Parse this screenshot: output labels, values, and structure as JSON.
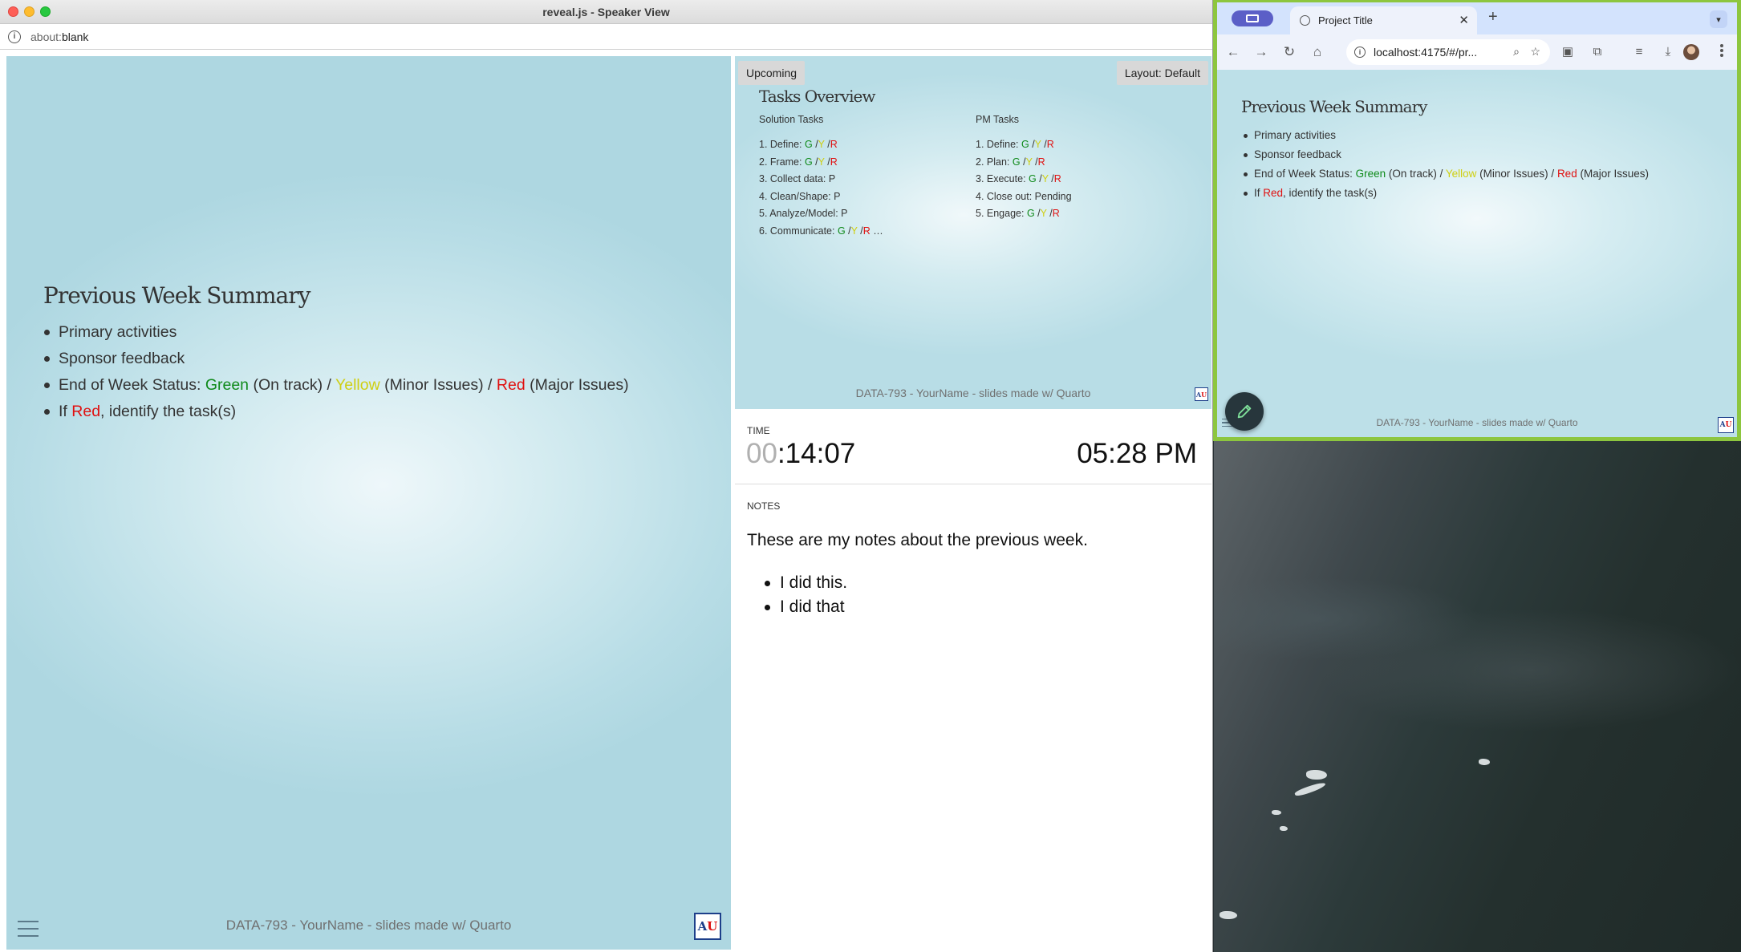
{
  "speaker_window": {
    "title": "reveal.js - Speaker View",
    "url_prefix": "about:",
    "url_rest": "blank"
  },
  "current_slide": {
    "title": "Previous Week Summary",
    "bullets": {
      "b1": "Primary activities",
      "b2": "Sponsor feedback",
      "b3_prefix": "End of Week Status: ",
      "b3_green": "Green",
      "b3_mid1": " (On track) / ",
      "b3_yellow": "Yellow",
      "b3_mid2": " (Minor Issues) / ",
      "b3_red": "Red",
      "b3_suffix": " (Major Issues)",
      "b4_prefix": "If ",
      "b4_red": "Red",
      "b4_suffix": ", identify the task(s)"
    },
    "footer": "DATA-793 - YourName - slides made w/ Quarto",
    "logo_left": "A",
    "logo_right": "U"
  },
  "upcoming": {
    "label": "Upcoming",
    "layout_label": "Layout: Default",
    "title": "Tasks Overview",
    "solution_title": "Solution Tasks",
    "pm_title": "PM Tasks",
    "gyr": {
      "g": "G",
      "sep1": " /",
      "y": "Y",
      "sep2": " /",
      "r": "R"
    },
    "solution_tasks": {
      "t1": "1. Define: ",
      "t2": "2. Frame: ",
      "t3": "3. Collect data: P",
      "t4": "4. Clean/Shape: P",
      "t5": "5. Analyze/Model: P",
      "t6": "6. Communicate: ",
      "t6_ellipsis": " …"
    },
    "pm_tasks": {
      "t1": "1. Define: ",
      "t2": "2. Plan: ",
      "t3": "3. Execute: ",
      "t4": "4. Close out: Pending",
      "t5": "5. Engage: "
    },
    "footer": "DATA-793 - YourName - slides made w/ Quarto"
  },
  "time": {
    "label": "TIME",
    "elapsed_hours": "00",
    "elapsed_rest": ":14:07",
    "clock": "05:28 PM"
  },
  "notes": {
    "label": "NOTES",
    "text": "These are my notes about the previous week.",
    "items": [
      "I did this.",
      "I did that"
    ]
  },
  "browser": {
    "tab_title": "Project Title",
    "tab_close": "✕",
    "new_tab": "+",
    "url": "localhost:4175/#/pr...",
    "slide_title": "Previous Week Summary",
    "footer": "DATA-793 - YourName - slides made w/ Quarto"
  },
  "colors": {
    "green": "#0f8a1a",
    "yellow": "#cfcf12",
    "red": "#e01010",
    "window_border": "#8dc63f"
  }
}
